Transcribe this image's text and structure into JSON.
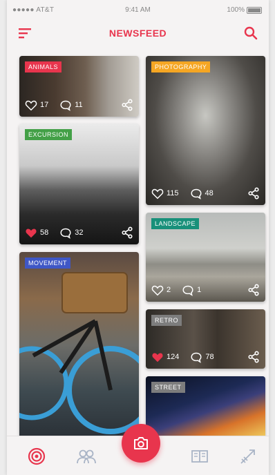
{
  "status_bar": {
    "carrier": "●●●●● AT&T",
    "time": "9:41 AM",
    "battery": "100%"
  },
  "header": {
    "title": "NEWSFEED"
  },
  "colors": {
    "accent": "#e8354d",
    "tag_red": "#e8354d",
    "tag_green": "#43a047",
    "tag_orange": "#f5a623",
    "tag_blue": "#3f57c6",
    "tag_teal": "#18907a",
    "tag_gray": "#7d7d7d"
  },
  "cards": [
    {
      "tag": "ANIMALS",
      "likes": "17",
      "comments": "11",
      "liked": false
    },
    {
      "tag": "PHOTOGRAPHY",
      "likes": "115",
      "comments": "48",
      "liked": false
    },
    {
      "tag": "EXCURSION",
      "likes": "58",
      "comments": "32",
      "liked": true
    },
    {
      "tag": "LANDSCAPE",
      "likes": "2",
      "comments": "1",
      "liked": false
    },
    {
      "tag": "MOVEMENT",
      "likes": "",
      "comments": "",
      "liked": false
    },
    {
      "tag": "RETRO",
      "likes": "124",
      "comments": "78",
      "liked": true
    },
    {
      "tag": "STREET",
      "likes": "",
      "comments": "",
      "liked": false
    }
  ],
  "bottom_nav": {
    "items": [
      {
        "icon": "target-icon",
        "active": true
      },
      {
        "icon": "people-icon",
        "active": false
      },
      {
        "icon": "camera-icon",
        "active": false
      },
      {
        "icon": "book-icon",
        "active": false
      },
      {
        "icon": "arrow-icon",
        "active": false
      }
    ]
  }
}
